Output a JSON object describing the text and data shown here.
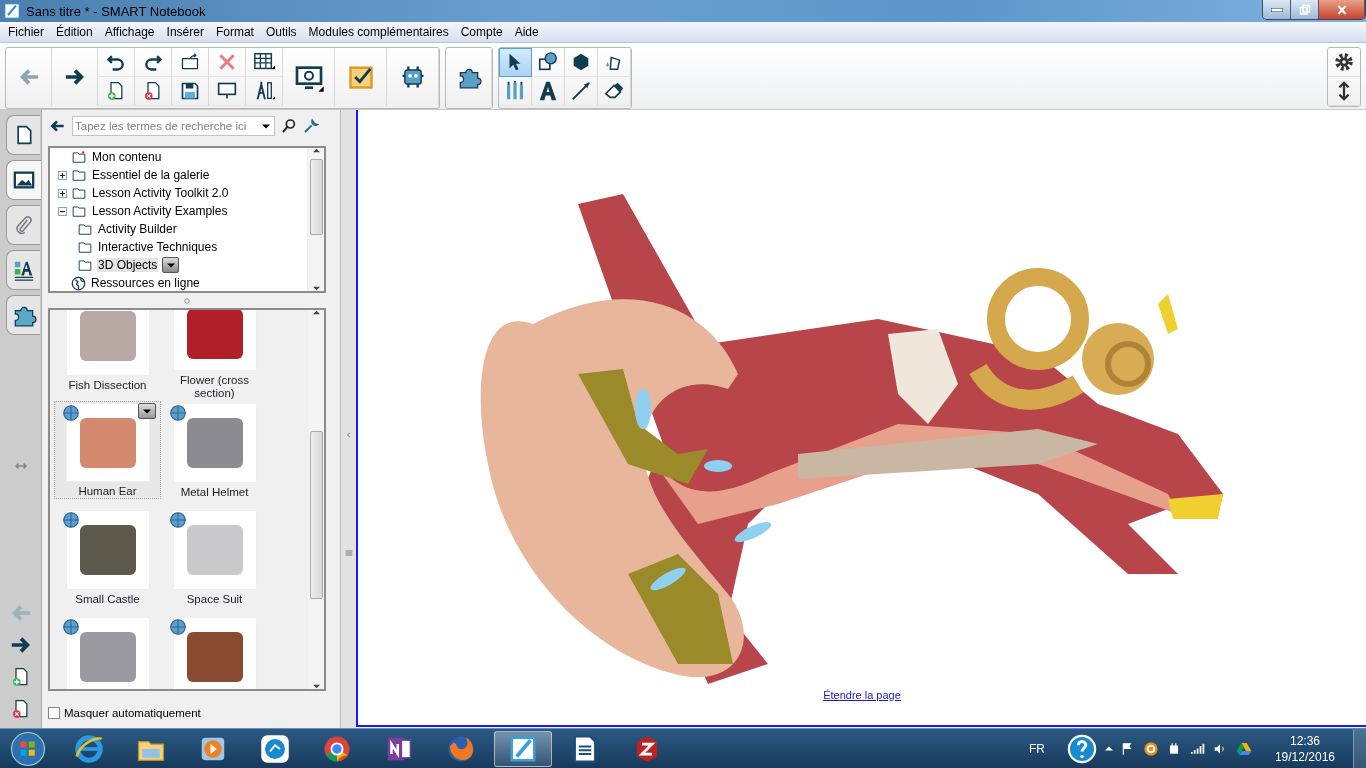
{
  "window": {
    "title": "Sans titre * - SMART Notebook"
  },
  "menu": [
    "Fichier",
    "Édition",
    "Affichage",
    "Insérer",
    "Format",
    "Outils",
    "Modules complémentaires",
    "Compte",
    "Aide"
  ],
  "toolbar": {
    "back": {
      "disabled": true
    },
    "forward": {
      "disabled": false
    },
    "drawing_tools": [
      {
        "kind": "select",
        "selected": true
      },
      {
        "kind": "shapes",
        "selected": false
      },
      {
        "kind": "polygon",
        "selected": false
      },
      {
        "kind": "fill",
        "selected": false
      },
      {
        "kind": "pens",
        "selected": false
      },
      {
        "kind": "text",
        "selected": false
      },
      {
        "kind": "line",
        "selected": false
      },
      {
        "kind": "eraser",
        "selected": false
      }
    ]
  },
  "side_tabs": [
    {
      "kind": "pages",
      "selected": false
    },
    {
      "kind": "gallery",
      "selected": true
    },
    {
      "kind": "attachments",
      "selected": false
    },
    {
      "kind": "properties",
      "selected": false
    },
    {
      "kind": "addons",
      "selected": false
    }
  ],
  "page_nav": {
    "previous": {
      "disabled": true
    },
    "next": {
      "disabled": false
    }
  },
  "gallery": {
    "search": {
      "placeholder": "Tapez les termes de recherche ici"
    },
    "tree": [
      {
        "label": "Mon contenu",
        "kind": "my-content",
        "selected": false
      },
      {
        "label": "Essentiel de la galerie",
        "kind": "folder",
        "selected": false,
        "expanded": false
      },
      {
        "label": "Lesson Activity Toolkit 2.0",
        "kind": "folder",
        "selected": false,
        "expanded": false
      },
      {
        "label": "Lesson Activity Examples",
        "kind": "folder",
        "selected": false,
        "expanded": true,
        "children": [
          {
            "label": "Activity Builder",
            "kind": "folder",
            "selected": false
          },
          {
            "label": "Interactive Techniques",
            "kind": "folder",
            "selected": false
          },
          {
            "label": "3D Objects",
            "kind": "folder",
            "selected": true
          }
        ]
      },
      {
        "label": "Ressources en ligne",
        "kind": "online",
        "selected": false
      }
    ],
    "items": [
      {
        "label": "Fish Dissection",
        "kind": "fish",
        "globe": false,
        "selected": false
      },
      {
        "label": "Flower (cross section)",
        "kind": "flower",
        "globe": false,
        "selected": false
      },
      {
        "label": "Human Ear",
        "kind": "ear",
        "globe": true,
        "selected": true
      },
      {
        "label": "Metal Helmet",
        "kind": "helmet",
        "globe": true,
        "selected": false
      },
      {
        "label": "Small Castle",
        "kind": "castle",
        "globe": true,
        "selected": false
      },
      {
        "label": "Space Suit",
        "kind": "suit",
        "globe": true,
        "selected": false
      },
      {
        "kind": "sword",
        "globe": true,
        "selected": false
      },
      {
        "kind": "volcano",
        "globe": true,
        "selected": false
      }
    ],
    "auto_hide": {
      "label": "Masquer automatiquement",
      "checked": false
    }
  },
  "canvas": {
    "extend_link": "Étendre la page"
  },
  "taskbar": {
    "apps": [
      {
        "kind": "browser-e",
        "selected": false
      },
      {
        "kind": "folder",
        "selected": false
      },
      {
        "kind": "media",
        "selected": false
      },
      {
        "kind": "share",
        "selected": false
      },
      {
        "kind": "chrome",
        "selected": false
      },
      {
        "kind": "notes",
        "selected": false
      },
      {
        "kind": "fox",
        "selected": false
      },
      {
        "kind": "notebook",
        "selected": true
      },
      {
        "kind": "document",
        "selected": false
      },
      {
        "kind": "z-app",
        "selected": false
      }
    ],
    "language": "FR",
    "time": "12:36",
    "date": "19/12/2016"
  }
}
